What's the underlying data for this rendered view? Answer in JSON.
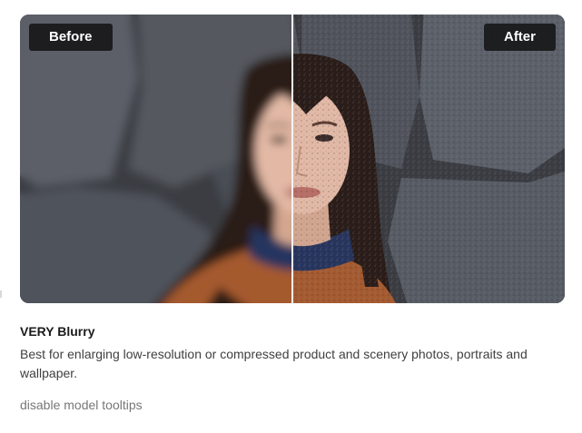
{
  "comparison": {
    "before_label": "Before",
    "after_label": "After"
  },
  "model": {
    "title": "VERY Blurry",
    "description": "Best for enlarging low-resolution or compressed product and scenery photos, portraits and wallpaper."
  },
  "tooltip_toggle": {
    "label": "disable model tooltips"
  }
}
